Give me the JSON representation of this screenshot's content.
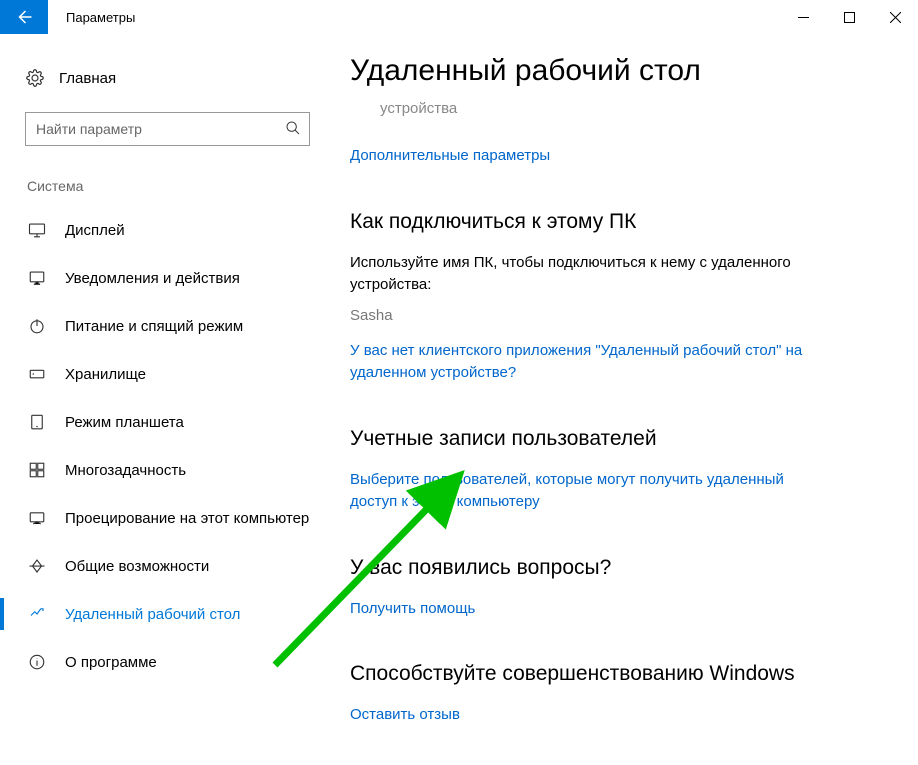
{
  "window": {
    "title": "Параметры"
  },
  "sidebar": {
    "home": "Главная",
    "search_placeholder": "Найти параметр",
    "group": "Система",
    "items": [
      {
        "label": "Дисплей"
      },
      {
        "label": "Уведомления и действия"
      },
      {
        "label": "Питание и спящий режим"
      },
      {
        "label": "Хранилище"
      },
      {
        "label": "Режим планшета"
      },
      {
        "label": "Многозадачность"
      },
      {
        "label": "Проецирование на этот компьютер"
      },
      {
        "label": "Общие возможности"
      },
      {
        "label": "Удаленный рабочий стол"
      },
      {
        "label": "О программе"
      }
    ]
  },
  "content": {
    "title": "Удаленный рабочий стол",
    "device_muted": "устройства",
    "link_advanced": "Дополнительные параметры",
    "connect_h": "Как подключиться к этому ПК",
    "connect_text": "Используйте имя ПК, чтобы подключиться к нему с удаленного устройства:",
    "pc_name": "Sasha",
    "link_noclient": "У вас нет клиентского приложения \"Удаленный рабочий стол\" на удаленном устройстве?",
    "accounts_h": "Учетные записи пользователей",
    "link_select_users": "Выберите пользователей, которые могут получить удаленный доступ к этому компьютеру",
    "questions_h": "У вас появились вопросы?",
    "link_help": "Получить помощь",
    "feedback_h": "Способствуйте совершенствованию Windows",
    "link_feedback": "Оставить отзыв"
  }
}
